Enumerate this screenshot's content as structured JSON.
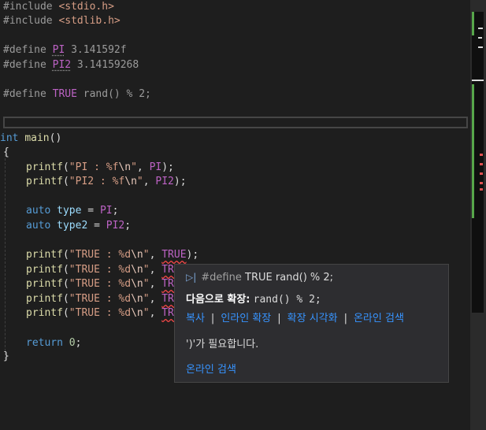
{
  "code": {
    "inc1": [
      "#include ",
      "<stdio.h>"
    ],
    "inc2": [
      "#include ",
      "<stdlib.h>"
    ],
    "def1": [
      "#define ",
      "PI",
      " 3.141592f"
    ],
    "def2": [
      "#define ",
      "PI2",
      " 3.14159268"
    ],
    "def3": [
      "#define ",
      "TRUE",
      " rand",
      "()",
      " % ",
      "2",
      ";"
    ],
    "main": [
      "int",
      " ",
      "main",
      "()"
    ],
    "open_brace": "{",
    "printf1": [
      "printf",
      "(",
      "\"PI : %f",
      "\\n",
      "\"",
      ", ",
      "PI",
      ");"
    ],
    "printf2": [
      "printf",
      "(",
      "\"PI2 : %f",
      "\\n",
      "\"",
      ", ",
      "PI2",
      ");"
    ],
    "auto1": [
      "auto",
      " ",
      "type",
      " = ",
      "PI",
      ";"
    ],
    "auto2": [
      "auto",
      " ",
      "type2",
      " = ",
      "PI2",
      ";"
    ],
    "printf_true_full": [
      "printf",
      "(",
      "\"TRUE : %d",
      "\\n",
      "\"",
      ", ",
      "TRUE",
      ");"
    ],
    "printf_true_part": [
      "printf",
      "(",
      "\"TRUE : %d",
      "\\n",
      "\"",
      ", ",
      "TRU"
    ],
    "return": [
      "return",
      " ",
      "0",
      ";"
    ],
    "close_brace": "}"
  },
  "popup": {
    "icon": "define-icon",
    "def_keyword": "#define",
    "def_name": "TRUE",
    "def_value": "rand() % 2;",
    "expand_label": "다음으로 확장:",
    "expand_value": "rand() % 2;",
    "links": [
      "복사",
      "인라인 확장",
      "확장 시각화",
      "온라인 검색"
    ],
    "separator": "|",
    "error_text": "')'가 필요합니다.",
    "search_link": "온라인 검색"
  },
  "colors": {
    "background": "#1e1e1e",
    "keyword": "#569cd6",
    "macro": "#bd63c5",
    "string": "#d69d85",
    "link": "#3794ff",
    "error_squiggle": "#f44747"
  }
}
